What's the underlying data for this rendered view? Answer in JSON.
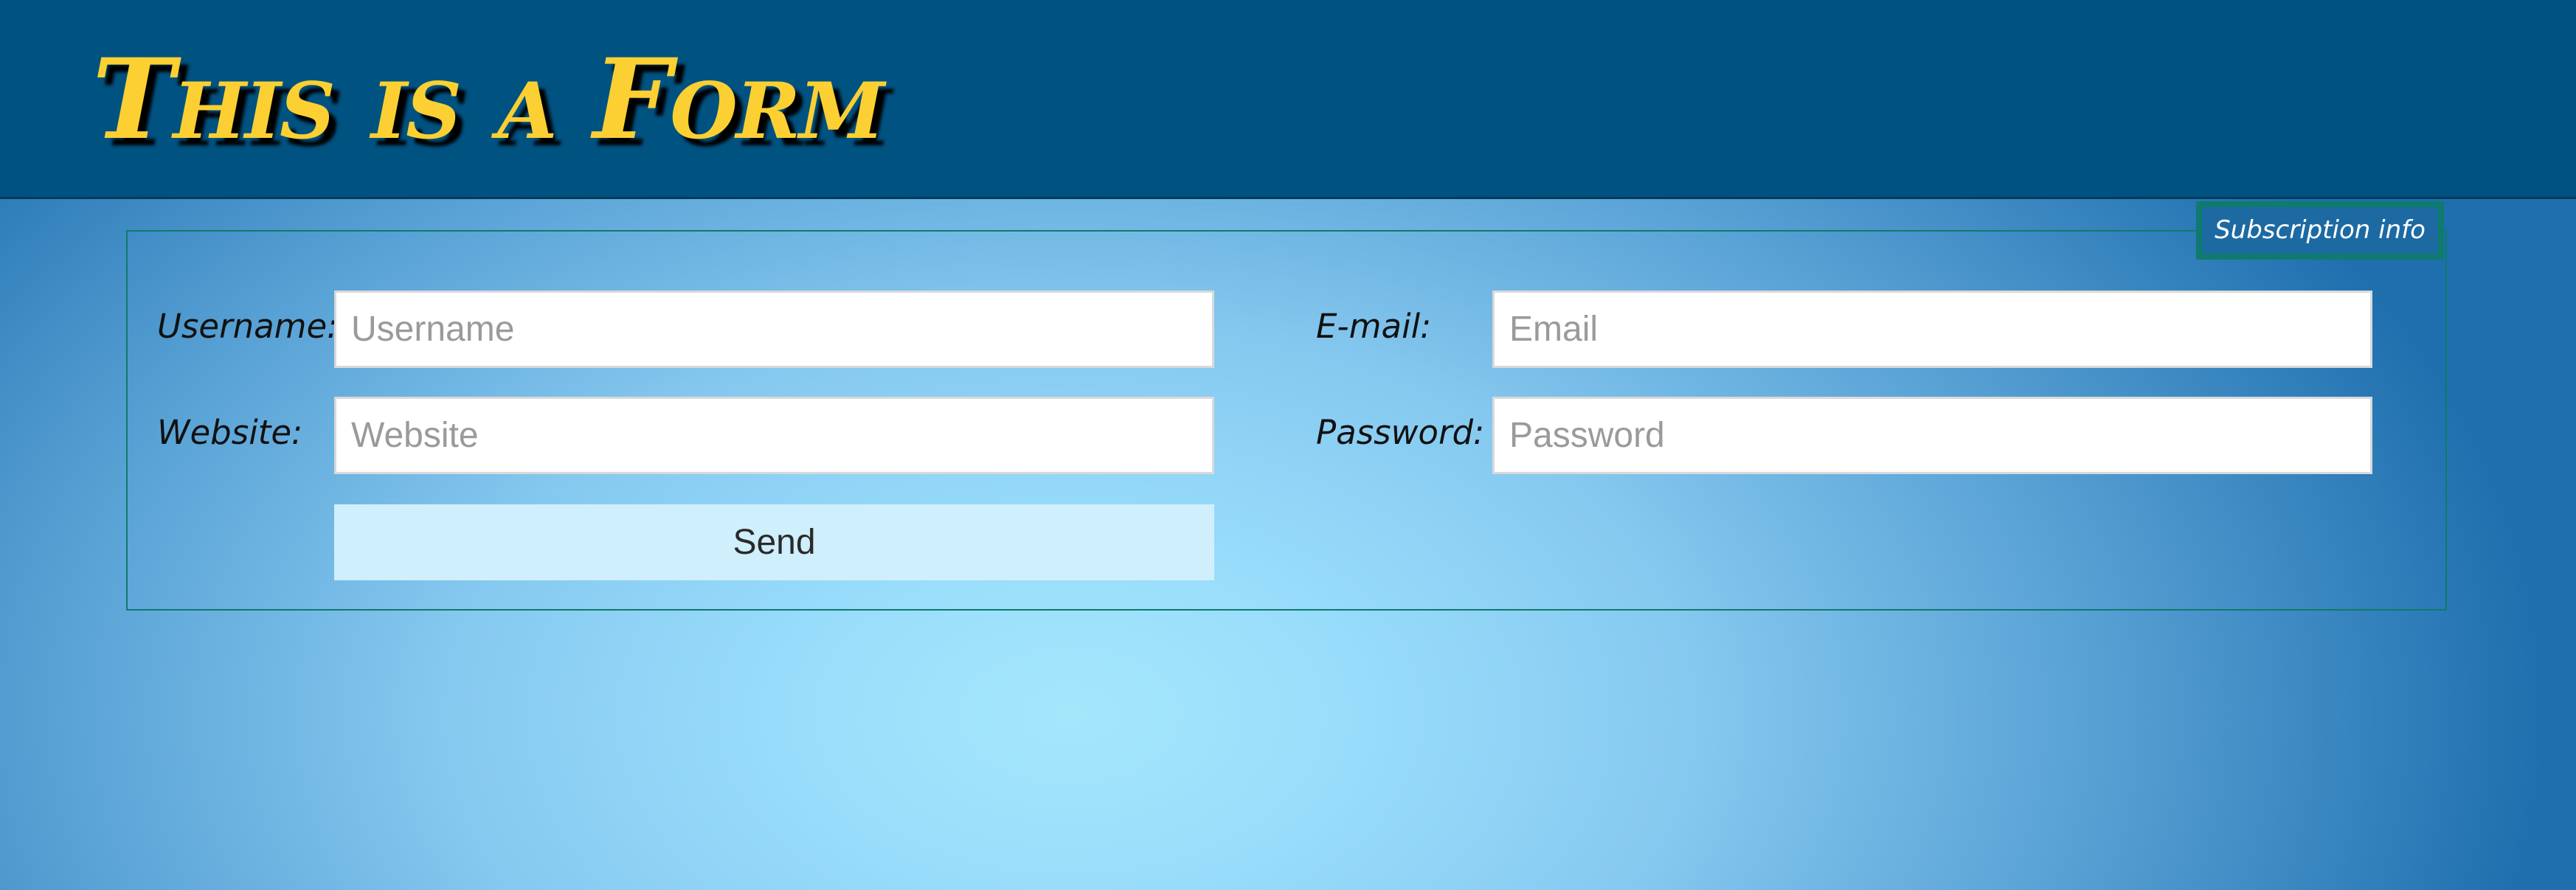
{
  "header": {
    "title": "This is a Form"
  },
  "form": {
    "legend": "Subscription info",
    "username": {
      "label": "Username:",
      "placeholder": "Username",
      "value": ""
    },
    "website": {
      "label": "Website:",
      "placeholder": "Website",
      "value": ""
    },
    "email": {
      "label": "E-mail:",
      "placeholder": "Email",
      "value": ""
    },
    "password": {
      "label": "Password:",
      "placeholder": "Password",
      "value": ""
    },
    "send_label": "Send"
  },
  "colors": {
    "header_background": "#005281",
    "title_text": "#fcd032",
    "fieldset_border": "#0f7a6e",
    "send_button_background": "#d0effd"
  }
}
